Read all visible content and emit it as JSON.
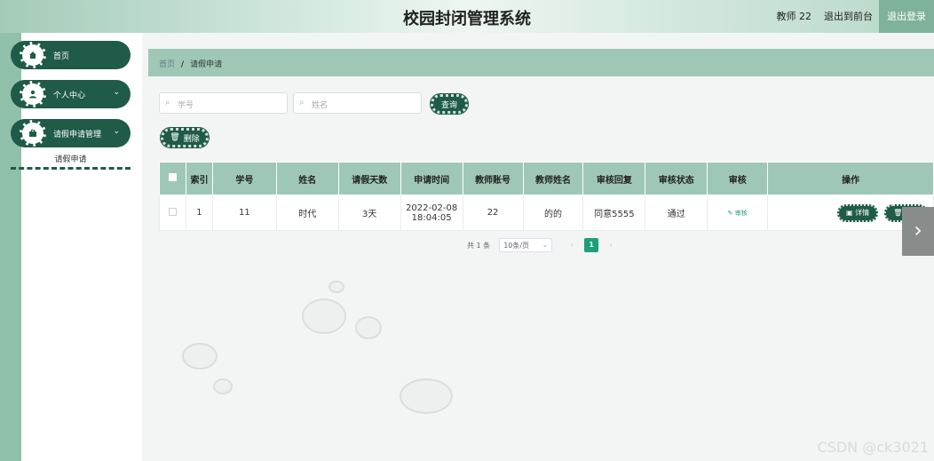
{
  "header": {
    "title": "校园封闭管理系统",
    "user": "教师 22",
    "back_label": "退出到前台",
    "logout_label": "退出登录"
  },
  "sidebar": {
    "items": [
      {
        "label": "首页",
        "icon": "home-icon"
      },
      {
        "label": "个人中心",
        "icon": "user-icon",
        "arrow": "⌄"
      },
      {
        "label": "请假申请管理",
        "icon": "briefcase-icon",
        "arrow": "⌄"
      }
    ],
    "sub_item": "请假申请"
  },
  "breadcrumb": {
    "home": "首页",
    "sep": "/",
    "current": "请假申请"
  },
  "search": {
    "student_no_placeholder": "学号",
    "name_placeholder": "姓名",
    "query_label": "查询",
    "delete_label": "删除"
  },
  "table": {
    "headers": [
      "索引",
      "学号",
      "姓名",
      "请假天数",
      "申请时间",
      "教师账号",
      "教师姓名",
      "审核回复",
      "审核状态",
      "审核",
      "操作"
    ],
    "rows": [
      {
        "index": "1",
        "student_no": "11",
        "name": "时代",
        "days": "3天",
        "time_date": "2022-02-08",
        "time_clock": "18:04:05",
        "teacher_account": "22",
        "teacher_name": "的的",
        "reply": "同意5555",
        "status": "通过",
        "audit_label": "审核",
        "detail_label": "详情",
        "delete_label": "删除"
      }
    ]
  },
  "pagination": {
    "total": "共 1 条",
    "page_size": "10条/页",
    "prev": "‹",
    "current": "1",
    "next": "›"
  },
  "nav": {
    "next_arrow": "›"
  },
  "watermark": "CSDN @ck3021",
  "colors": {
    "primary": "#1f5b48",
    "accent": "#9ec8b5",
    "link": "#1aa07a"
  }
}
